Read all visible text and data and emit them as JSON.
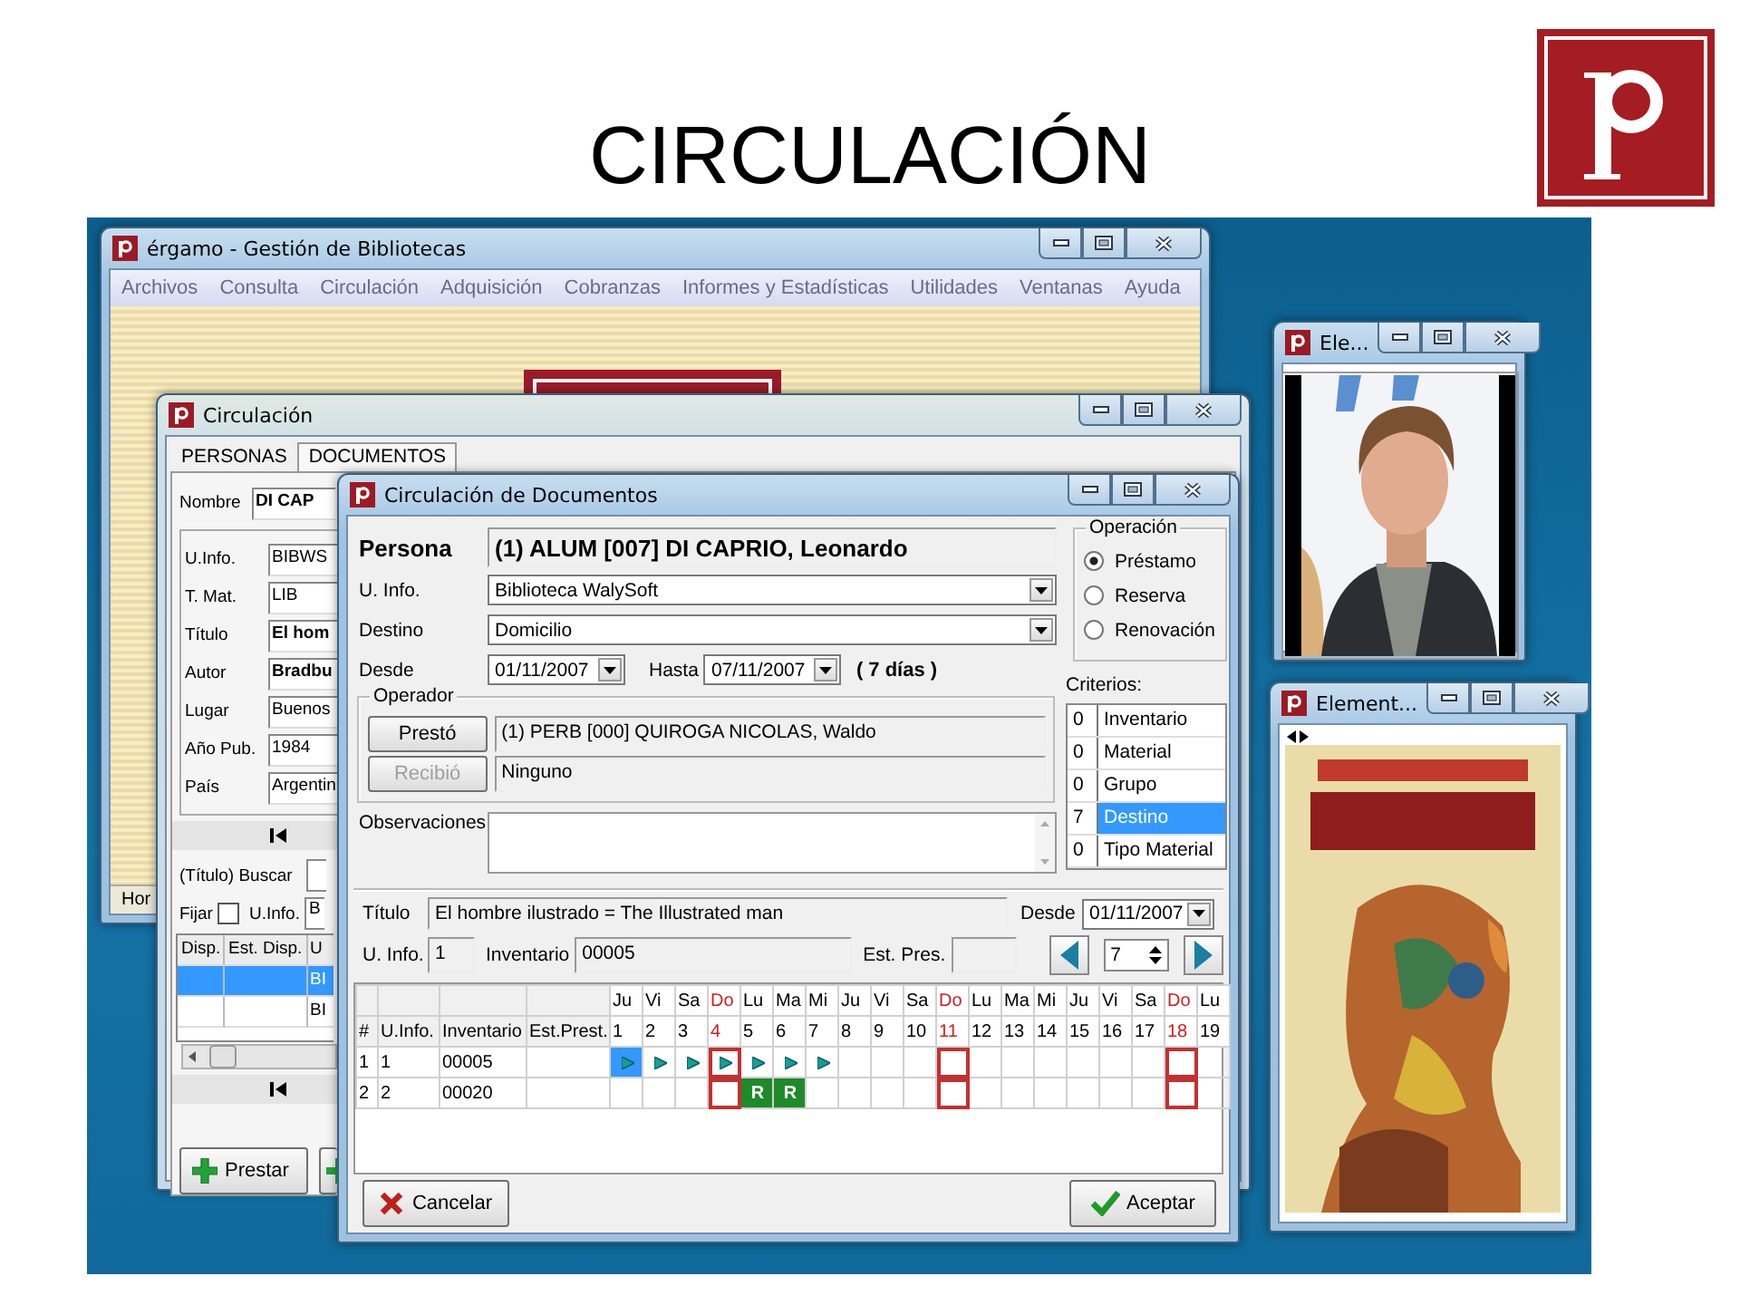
{
  "slide": {
    "title": "CIRCULACIÓN"
  },
  "main_window": {
    "title": "érgamo - Gestión de Bibliotecas",
    "menu": [
      "Archivos",
      "Consulta",
      "Circulación",
      "Adquisición",
      "Cobranzas",
      "Informes y Estadísticas",
      "Utilidades",
      "Ventanas",
      "Ayuda"
    ],
    "status_bar": "Hor"
  },
  "circulation_window": {
    "title": "Circulación",
    "tabs": [
      {
        "label": "PERSONAS",
        "selected": false
      },
      {
        "label": "DOCUMENTOS",
        "selected": true
      }
    ],
    "name": {
      "label": "Nombre",
      "value": "DI CAP"
    },
    "fields": [
      {
        "label": "U.Info.",
        "value": "BIBWS",
        "bold": false
      },
      {
        "label": "T. Mat.",
        "value": "LIB",
        "bold": false
      },
      {
        "label": "Título",
        "value": "El hom",
        "bold": true
      },
      {
        "label": "Autor",
        "value": "Bradbu",
        "bold": true
      },
      {
        "label": "Lugar",
        "value": "Buenos",
        "bold": false
      },
      {
        "label": "Año Pub.",
        "value": "1984",
        "bold": false
      },
      {
        "label": "País",
        "value": "Argentin",
        "bold": false
      }
    ],
    "search": {
      "label": "(Título) Buscar"
    },
    "pin": {
      "label": "Fijar",
      "checked": false
    },
    "u_info": {
      "label": "U.Info.",
      "value": "B"
    },
    "table": {
      "columns": [
        "Disp.",
        "Est. Disp.",
        "U"
      ],
      "rows": [
        {
          "selected": true,
          "column_3": "BI"
        },
        {
          "selected": false,
          "column_3": "BI"
        }
      ]
    },
    "buttons": [
      {
        "label": "Prestar"
      }
    ]
  },
  "docs_window": {
    "title": "Circulación de Documentos",
    "person": {
      "label": "Persona",
      "value": "(1) ALUM [007] DI CAPRIO, Leonardo"
    },
    "u_info": {
      "label": "U. Info.",
      "value": "Biblioteca WalySoft"
    },
    "destination": {
      "label": "Destino",
      "value": "Domicilio"
    },
    "from": {
      "label": "Desde",
      "value": "01/11/2007"
    },
    "to": {
      "label": "Hasta",
      "value": "07/11/2007"
    },
    "duration": "( 7 días )",
    "operator": {
      "title": "Operador",
      "rows": [
        {
          "button": "Prestó",
          "disabled": false,
          "value": "(1) PERB [000] QUIROGA NICOLAS, Waldo"
        },
        {
          "button": "Recibió",
          "disabled": true,
          "value": "Ninguno"
        }
      ]
    },
    "notes": {
      "label": "Observaciones"
    },
    "operation": {
      "title": "Operación",
      "options": [
        {
          "label": "Préstamo",
          "selected": true
        },
        {
          "label": "Reserva",
          "selected": false
        },
        {
          "label": "Renovación",
          "selected": false
        }
      ]
    },
    "criteria": {
      "label": "Criterios:",
      "items": [
        {
          "count": "0",
          "label": "Inventario",
          "selected": false
        },
        {
          "count": "0",
          "label": "Material",
          "selected": false
        },
        {
          "count": "0",
          "label": "Grupo",
          "selected": false
        },
        {
          "count": "7",
          "label": "Destino",
          "selected": true
        },
        {
          "count": "0",
          "label": "Tipo Material",
          "selected": false
        }
      ]
    },
    "document": {
      "title_label": "Título",
      "title_value": "El hombre ilustrado = The Illustrated man",
      "from_label": "Desde",
      "from_value": "01/11/2007",
      "u_info_label": "U. Info.",
      "u_info_value": "1",
      "inventory_label": "Inventario",
      "inventory_value": "00005",
      "status_label": "Est. Pres.",
      "days_value": "7"
    },
    "grid": {
      "columns": [
        "#",
        "U.Info.",
        "Inventario",
        "Est.Prest."
      ],
      "days": [
        {
          "weekday": "Ju",
          "date": "1",
          "sunday": false
        },
        {
          "weekday": "Vi",
          "date": "2",
          "sunday": false
        },
        {
          "weekday": "Sa",
          "date": "3",
          "sunday": false
        },
        {
          "weekday": "Do",
          "date": "4",
          "sunday": true
        },
        {
          "weekday": "Lu",
          "date": "5",
          "sunday": false
        },
        {
          "weekday": "Ma",
          "date": "6",
          "sunday": false
        },
        {
          "weekday": "Mi",
          "date": "7",
          "sunday": false
        },
        {
          "weekday": "Ju",
          "date": "8",
          "sunday": false
        },
        {
          "weekday": "Vi",
          "date": "9",
          "sunday": false
        },
        {
          "weekday": "Sa",
          "date": "10",
          "sunday": false
        },
        {
          "weekday": "Do",
          "date": "11",
          "sunday": true
        },
        {
          "weekday": "Lu",
          "date": "12",
          "sunday": false
        },
        {
          "weekday": "Ma",
          "date": "13",
          "sunday": false
        },
        {
          "weekday": "Mi",
          "date": "14",
          "sunday": false
        },
        {
          "weekday": "Ju",
          "date": "15",
          "sunday": false
        },
        {
          "weekday": "Vi",
          "date": "16",
          "sunday": false
        },
        {
          "weekday": "Sa",
          "date": "17",
          "sunday": false
        },
        {
          "weekday": "Do",
          "date": "18",
          "sunday": true
        },
        {
          "weekday": "Lu",
          "date": "19",
          "sunday": false
        }
      ],
      "rows": [
        {
          "number": "1",
          "u_info": "1",
          "inventory": "00005",
          "cells": [
            {
              "kind": "loan",
              "selected": true
            },
            {
              "kind": "loan",
              "selected": false
            },
            {
              "kind": "loan",
              "selected": false
            },
            {
              "kind": "loan",
              "selected": false
            },
            {
              "kind": "loan",
              "selected": false
            },
            {
              "kind": "loan",
              "selected": false
            },
            {
              "kind": "loan",
              "selected": false
            },
            {
              "kind": "free",
              "selected": false
            },
            {
              "kind": "free",
              "selected": false
            },
            {
              "kind": "free",
              "selected": false
            },
            {
              "kind": "free",
              "selected": false
            },
            {
              "kind": "free",
              "selected": false
            },
            {
              "kind": "free",
              "selected": false
            },
            {
              "kind": "free",
              "selected": false
            },
            {
              "kind": "free",
              "selected": false
            },
            {
              "kind": "free",
              "selected": false
            },
            {
              "kind": "free",
              "selected": false
            },
            {
              "kind": "free",
              "selected": false
            },
            {
              "kind": "free",
              "selected": false
            }
          ]
        },
        {
          "number": "2",
          "u_info": "2",
          "inventory": "00020",
          "cells": [
            {
              "kind": "free",
              "selected": false
            },
            {
              "kind": "free",
              "selected": false
            },
            {
              "kind": "free",
              "selected": false
            },
            {
              "kind": "free",
              "selected": false
            },
            {
              "kind": "reserved",
              "text": "R",
              "selected": false
            },
            {
              "kind": "reserved",
              "text": "R",
              "selected": false
            },
            {
              "kind": "free",
              "selected": false
            },
            {
              "kind": "free",
              "selected": false
            },
            {
              "kind": "free",
              "selected": false
            },
            {
              "kind": "free",
              "selected": false
            },
            {
              "kind": "free",
              "selected": false
            },
            {
              "kind": "free",
              "selected": false
            },
            {
              "kind": "free",
              "selected": false
            },
            {
              "kind": "free",
              "selected": false
            },
            {
              "kind": "free",
              "selected": false
            },
            {
              "kind": "free",
              "selected": false
            },
            {
              "kind": "free",
              "selected": false
            },
            {
              "kind": "free",
              "selected": false
            },
            {
              "kind": "free",
              "selected": false
            }
          ]
        }
      ]
    },
    "buttons": [
      {
        "label": "Cancelar",
        "kind": "cancel"
      },
      {
        "label": "Aceptar",
        "kind": "accept"
      }
    ]
  },
  "photo_window": {
    "title": "Ele..."
  },
  "cover_window": {
    "title": "Element..."
  }
}
